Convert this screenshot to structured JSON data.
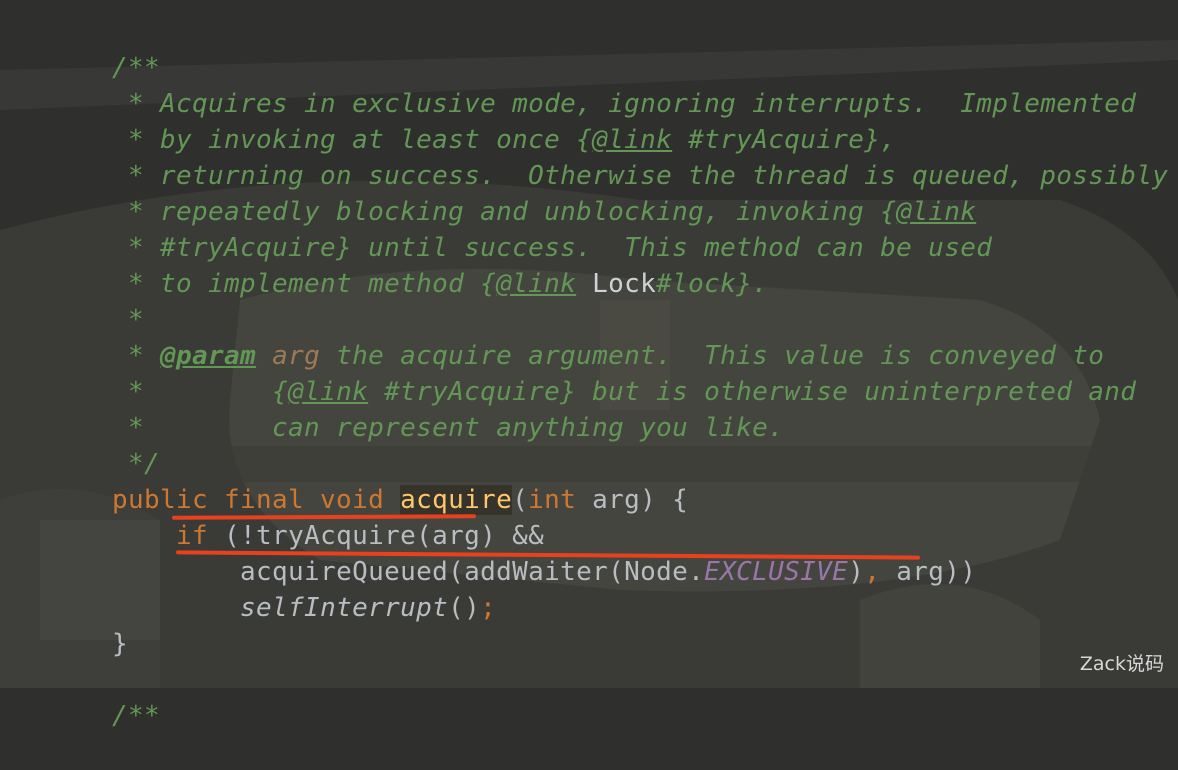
{
  "doc_comment_1": {
    "l1": "/**",
    "l2": " * Acquires in exclusive mode, ignoring interrupts.  Implemented",
    "l3": {
      "a": " * by invoking at least once ",
      "open": "{",
      "link": "@link",
      "ref": " #tryAcquire}",
      "b": ","
    },
    "l4": " * returning on success.  Otherwise the thread is queued, possibly",
    "l5": {
      "a": " * repeatedly blocking and unblocking, invoking ",
      "open": "{",
      "link": "@link"
    },
    "l6": " * #tryAcquire} until success.  This method can be used",
    "l7": {
      "a": " * to implement method ",
      "open": "{",
      "link": "@link",
      "sp": " ",
      "cls": "Lock",
      "ref": "#lock}",
      "b": "."
    },
    "l8": " *",
    "l9": {
      "a": " * ",
      "tag": "@param",
      "sp": " ",
      "pname": "arg",
      "b": " the acquire argument.  This value is conveyed to"
    },
    "l10": {
      "a": " *        ",
      "open": "{",
      "link": "@link",
      "b": " #tryAcquire} but is otherwise uninterpreted and"
    },
    "l11": " *        can represent anything you like.",
    "l12": " */"
  },
  "method": {
    "modifiers": "public final void ",
    "name": "acquire",
    "open": "(",
    "param_type": "int",
    "param_rest": " arg) {",
    "if_indent": "    ",
    "if_kw": "if",
    "if_rest": " (!tryAcquire(arg) ",
    "and_op": "&&",
    "call_indent": "        ",
    "call_a": "acquireQueued(addWaiter(Node.",
    "constant": "EXCLUSIVE",
    "call_b": ")",
    "comma": ",",
    "call_c": " arg))",
    "self_indent": "        ",
    "self_call": "selfInterrupt",
    "self_paren": "()",
    "semicolon": ";",
    "close": "}"
  },
  "doc_comment_2": {
    "l1": "/**"
  },
  "watermark": "Zack说码",
  "colors": {
    "background": "#2f2f2d",
    "comment": "#629755",
    "keyword": "#cc7832",
    "function": "#ffc66d",
    "text": "#b8bdc1",
    "constant": "#9876aa",
    "annotation_underline": "#e8411e"
  }
}
